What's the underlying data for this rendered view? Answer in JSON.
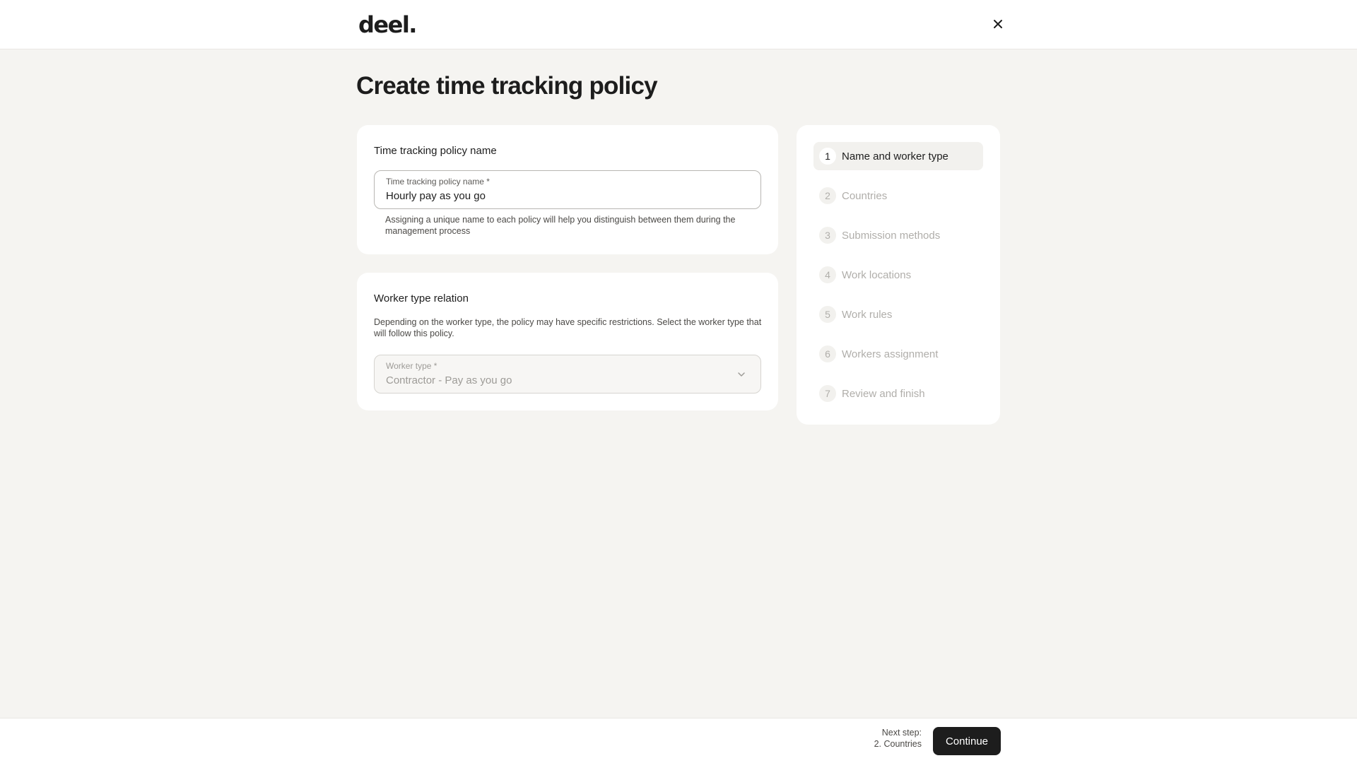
{
  "header": {
    "logo_text": "deel.",
    "close_icon": "close-icon"
  },
  "page": {
    "title": "Create time tracking policy"
  },
  "name_card": {
    "heading": "Time tracking policy name",
    "field": {
      "label": "Time tracking policy name *",
      "value": "Hourly pay as you go"
    },
    "helper": "Assigning a unique name to each policy will help you distinguish between them during the management process"
  },
  "worker_card": {
    "heading": "Worker type relation",
    "description": "Depending on the worker type, the policy may have specific restrictions. Select the worker type that will follow this policy.",
    "field": {
      "label": "Worker type *",
      "value": "Contractor - Pay as you go",
      "icon": "chevron-down-icon"
    }
  },
  "steps": [
    {
      "number": "1",
      "label": "Name and worker type",
      "active": true
    },
    {
      "number": "2",
      "label": "Countries",
      "active": false
    },
    {
      "number": "3",
      "label": "Submission methods",
      "active": false
    },
    {
      "number": "4",
      "label": "Work locations",
      "active": false
    },
    {
      "number": "5",
      "label": "Work rules",
      "active": false
    },
    {
      "number": "6",
      "label": "Workers assignment",
      "active": false
    },
    {
      "number": "7",
      "label": "Review and finish",
      "active": false
    }
  ],
  "footer": {
    "next_step_label": "Next step:",
    "next_step_value": "2. Countries",
    "continue_label": "Continue"
  },
  "colors": {
    "background": "#f5f4f1",
    "card": "#ffffff",
    "primary_button": "#1d1d1d",
    "muted_text": "#b0aeaa"
  }
}
